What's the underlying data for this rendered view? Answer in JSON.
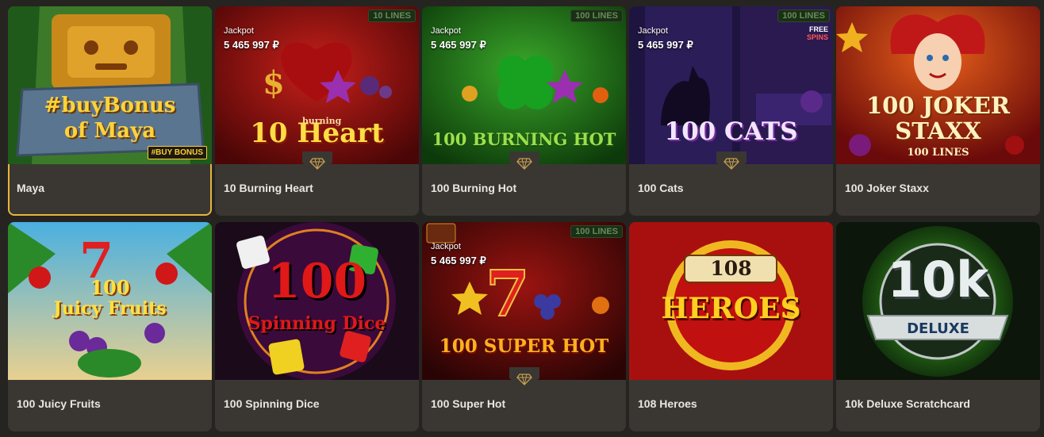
{
  "games": [
    {
      "title": "Maya",
      "logo_line1": "#buyBonus",
      "logo_line2": "of Maya",
      "badge": "#BUY BONUS"
    },
    {
      "title": "10 Burning Heart",
      "jackpot_label": "Jackpot",
      "jackpot_value": "5 465 997 ₽",
      "logo_main": "10 Heart",
      "logo_small": "burning",
      "lines_badge": "10 LINES"
    },
    {
      "title": "100 Burning Hot",
      "jackpot_label": "Jackpot",
      "jackpot_value": "5 465 997 ₽",
      "logo_main": "100 BURNING HOT",
      "lines_badge": "100 LINES"
    },
    {
      "title": "100 Cats",
      "jackpot_label": "Jackpot",
      "jackpot_value": "5 465 997 ₽",
      "logo_main": "100 CATS",
      "lines_badge": "100 LINES",
      "spins_badge_1": "FREE",
      "spins_badge_2": "SPINS"
    },
    {
      "title": "100 Joker Staxx",
      "logo_line1": "100 JOKER",
      "logo_line2": "STAXX",
      "logo_line3": "100 LINES"
    },
    {
      "title": "100 Juicy Fruits",
      "logo_line1": "100",
      "logo_line2": "Juicy Fruits"
    },
    {
      "title": "100 Spinning Dice",
      "logo_line1": "100",
      "logo_line2": "Spinning Dice"
    },
    {
      "title": "100 Super Hot",
      "jackpot_label": "Jackpot",
      "jackpot_value": "5 465 997 ₽",
      "logo_main": "100 SUPER HOT",
      "lines_badge": "100 LINES"
    },
    {
      "title": "108 Heroes",
      "logo_line1": "108",
      "logo_line2": "HEROES"
    },
    {
      "title": "10k Deluxe Scratchcard",
      "logo_line1": "10k",
      "logo_line2": "DELUXE"
    }
  ],
  "colors": {
    "page_bg": "#262420",
    "card_bg": "#3a3733",
    "title_text": "#e9e6e0",
    "accent_gold": "#e7b53a"
  },
  "icons": {
    "jackpot": "diamond-icon"
  }
}
